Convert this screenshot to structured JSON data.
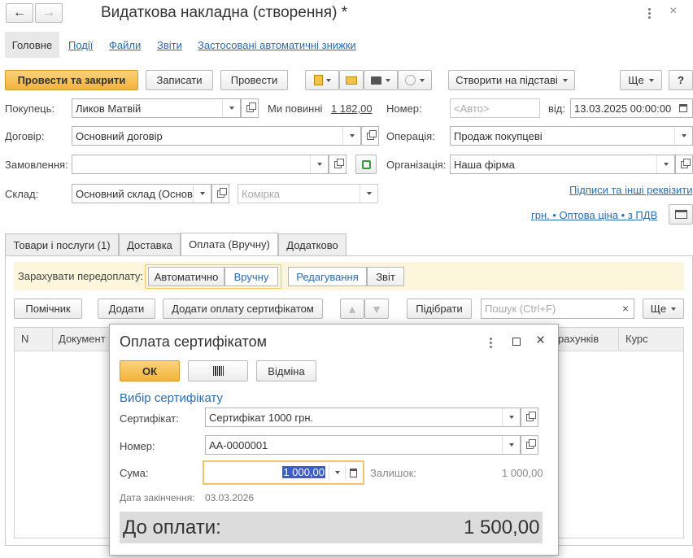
{
  "window": {
    "title": "Видаткова накладна (створення) *"
  },
  "nav": {
    "tabs": [
      "Головне",
      "Події",
      "Файли",
      "Звіти",
      "Застосовані автоматичні знижки"
    ]
  },
  "toolbar": {
    "post_close": "Провести та закрити",
    "save": "Записати",
    "post": "Провести",
    "create_based": "Створити на підставі",
    "more": "Ще",
    "help": "?"
  },
  "form": {
    "buyer_label": "Покупець:",
    "buyer_value": "Ликов Матвій",
    "owed_label": "Ми повинні",
    "owed_value": "1 182,00",
    "number_label": "Номер:",
    "number_placeholder": "<Авто>",
    "from_label": "від:",
    "date_value": "13.03.2025 00:00:00",
    "contract_label": "Договір:",
    "contract_value": "Основний договір",
    "operation_label": "Операція:",
    "operation_value": "Продаж покупцеві",
    "order_label": "Замовлення:",
    "org_label": "Організація:",
    "org_value": "Наша фірма",
    "warehouse_label": "Склад:",
    "warehouse_value": "Основний склад (Основ",
    "cell_placeholder": "Комірка",
    "signatures_link": "Підписи та інші реквізити",
    "price_link": "грн. • Оптова ціна • з ПДВ"
  },
  "doc_tabs": [
    "Товари і послуги (1)",
    "Доставка",
    "Оплата (Вручну)",
    "Додатково"
  ],
  "payment": {
    "prepay_label": "Зарахувати передоплату:",
    "auto": "Автоматично",
    "manual": "Вручну",
    "edit": "Редагування",
    "report": "Звіт",
    "helper": "Помічник",
    "add": "Додати",
    "add_cert": "Додати оплату сертифікатом",
    "select": "Підібрати",
    "search_placeholder": "Пошук (Ctrl+F)",
    "more": "Ще",
    "col_n": "N",
    "col_doc": "Документ",
    "col_accounts": "рахунків",
    "col_rate": "Курс"
  },
  "dialog": {
    "title": "Оплата сертифікатом",
    "ok": "ОК",
    "cancel": "Відміна",
    "section": "Вибір сертифікату",
    "cert_label": "Сертифікат:",
    "cert_value": "Сертифікат 1000 грн.",
    "number_label": "Номер:",
    "number_value": "АА-0000001",
    "sum_label": "Сума:",
    "sum_value": "1 000,00",
    "balance_label": "Залишок:",
    "balance_value": "1 000,00",
    "expiry_label": "Дата закінчення:",
    "expiry_value": "03.03.2026",
    "total_label": "До оплати:",
    "total_value": "1 500,00"
  }
}
